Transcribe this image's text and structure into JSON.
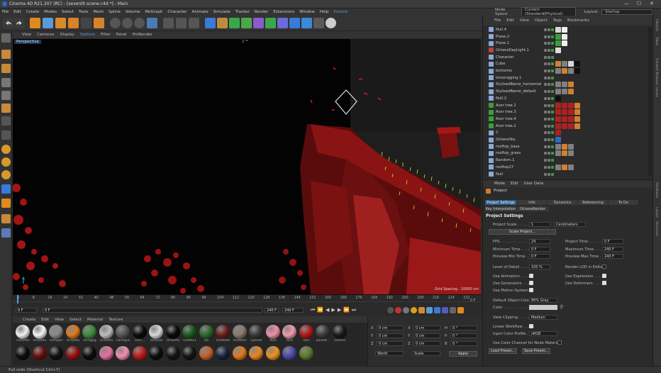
{
  "window": {
    "title": "Cinema 4D R21.207 (RC) - [seventh scene.c4d *] - Main"
  },
  "menu": [
    "File",
    "Edit",
    "Create",
    "Modes",
    "Select",
    "Tools",
    "Mesh",
    "Spline",
    "Volume",
    "MoGraph",
    "Character",
    "Animate",
    "Simulate",
    "Tracker",
    "Render",
    "Extensions",
    "Window",
    "Help",
    "Octane"
  ],
  "node_space": {
    "label": "Node Space:",
    "value": "Current (Standard/Physical)",
    "layout_label": "Layout:",
    "layout_value": "Startup"
  },
  "viewport_menu": [
    "View",
    "Cameras",
    "Display",
    "Options",
    "Filter",
    "Panel",
    "ProRender"
  ],
  "viewport": {
    "name": "Perspective",
    "top_label": "2 ⁰⁰",
    "grid_spacing": "Grid Spacing : 10000 cm"
  },
  "timeline": {
    "ticks": [
      "0",
      "8",
      "16",
      "24",
      "32",
      "40",
      "48",
      "56",
      "64",
      "72",
      "80",
      "88",
      "96",
      "104",
      "112",
      "120",
      "128",
      "136",
      "144",
      "152",
      "160",
      "168",
      "176",
      "184",
      "192",
      "200",
      "208",
      "216",
      "224",
      "232"
    ],
    "end_label": "0 F",
    "current": "0 F",
    "frame_field": "0 F",
    "start_field": "240 F",
    "end_field": "240 F"
  },
  "material_menu": [
    "Create",
    "Edit",
    "View",
    "Select",
    "Material",
    "Texture"
  ],
  "materials": [
    {
      "label": "OctDiffu",
      "color": "#f2f2f2"
    },
    {
      "label": "OctDiffu",
      "color": "#f5f5f5"
    },
    {
      "label": "OctSpec",
      "color": "#8a8a8a"
    },
    {
      "label": "OctDiffu",
      "color": "#e07a1e"
    },
    {
      "label": "stringlig",
      "color": "#3d8a3a"
    },
    {
      "label": "OctDiffu",
      "color": "#bdbdbd"
    },
    {
      "label": "cardrgisi",
      "color": "#555555"
    },
    {
      "label": "com...",
      "color": "#0b0b0b"
    },
    {
      "label": "OctGlos",
      "color": "#d8d8d8"
    },
    {
      "label": "OctDiffu",
      "color": "#0a0a0a"
    },
    {
      "label": "OctMix1",
      "color": "#1a5a1a"
    },
    {
      "label": "vei",
      "color": "#2a6a2a"
    },
    {
      "label": "OctMete",
      "color": "#6e1e1e"
    },
    {
      "label": "OctMete",
      "color": "#8a7a6a"
    },
    {
      "label": "eyesah",
      "color": "#3a3a3a"
    },
    {
      "label": "face",
      "color": "#ee8fa8"
    },
    {
      "label": "face",
      "color": "#f29bb0"
    },
    {
      "label": "hair",
      "color": "#b01818"
    },
    {
      "label": "packet...",
      "color": "#3a3a3a"
    },
    {
      "label": "clothes",
      "color": "#1a1a1a"
    },
    {
      "label": "",
      "color": "#0e0e0e"
    },
    {
      "label": "",
      "color": "#6a0f0f"
    },
    {
      "label": "",
      "color": "#111111"
    },
    {
      "label": "",
      "color": "#9a1010"
    },
    {
      "label": "",
      "color": "#0c0c0c"
    },
    {
      "label": "",
      "color": "#e86fa0"
    },
    {
      "label": "",
      "color": "#f08fb0"
    },
    {
      "label": "",
      "color": "#c41a1a"
    },
    {
      "label": "",
      "color": "#0d0d0d"
    },
    {
      "label": "",
      "color": "#151515"
    },
    {
      "label": "",
      "color": "#141414"
    },
    {
      "label": "",
      "color": "#c2602a"
    },
    {
      "label": "",
      "color": "#1a2440"
    },
    {
      "label": "",
      "color": "#e07a1e"
    },
    {
      "label": "",
      "color": "#e8871e"
    },
    {
      "label": "",
      "color": "#f0901e"
    },
    {
      "label": "",
      "color": "#4a4ab0"
    },
    {
      "label": "",
      "color": "#5a7a2a"
    }
  ],
  "coords": {
    "rows": [
      [
        "X",
        "0 cm",
        "X",
        "0 cm",
        "H",
        "0 °"
      ],
      [
        "Y",
        "0 cm",
        "Y",
        "0 cm",
        "P",
        "0 °"
      ],
      [
        "Z",
        "0 cm",
        "Z",
        "0 cm",
        "B",
        "0 °"
      ]
    ],
    "mode": "World",
    "scale": "Scale",
    "apply": "Apply"
  },
  "object_manager": {
    "menu": [
      "File",
      "Edit",
      "View",
      "Object",
      "Tags",
      "Bookmarks"
    ],
    "objects": [
      {
        "name": "Null.4",
        "color": "#8aa8d8",
        "tags": [
          "#d8d8d8",
          "#eee"
        ]
      },
      {
        "name": "Plane.2",
        "color": "#8aa8d8",
        "tags": [
          "#3c9c3c",
          "#f0f0f0"
        ]
      },
      {
        "name": "Plane.1",
        "color": "#8aa8d8",
        "tags": [
          "#3c9c3c",
          "#f0f0f0"
        ]
      },
      {
        "name": "OctaneDayLight.1",
        "color": "#c04040",
        "tags": [
          "#ddd"
        ]
      },
      {
        "name": "Character",
        "color": "#8aa8d8",
        "tags": []
      },
      {
        "name": "Cube",
        "color": "#8aa8d8",
        "tags": [
          "#d08030",
          "#808080",
          "#d8d8d8",
          "#101010"
        ]
      },
      {
        "name": "bottomis",
        "color": "#8aa8d8",
        "tags": [
          "#808080",
          "#d08030",
          "#808080",
          "#101010"
        ]
      },
      {
        "name": "torsorigging.1",
        "color": "#8aa8d8",
        "tags": []
      },
      {
        "name": "StylizedBarne_horizontal",
        "color": "#8aa8d8",
        "tags": [
          "#808080",
          "#808080",
          "#d08030"
        ]
      },
      {
        "name": "StylizedBarne_default",
        "color": "#8aa8d8",
        "tags": [
          "#808080",
          "#808080",
          "#d08030"
        ]
      },
      {
        "name": "Null.2",
        "color": "#8aa8d8",
        "tags": [
          "#101010"
        ]
      },
      {
        "name": "Acer tree.1",
        "color": "#3c9c3c",
        "tags": [
          "#b02020",
          "#b02020",
          "#b02020",
          "#d08030"
        ]
      },
      {
        "name": "Acer tree.3",
        "color": "#3c9c3c",
        "tags": [
          "#b02020",
          "#b02020",
          "#b02020",
          "#d08030"
        ]
      },
      {
        "name": "Acer tree.4",
        "color": "#3c9c3c",
        "tags": [
          "#b02020",
          "#b02020",
          "#b02020",
          "#d08030"
        ]
      },
      {
        "name": "Acer tree.2",
        "color": "#3c9c3c",
        "tags": [
          "#b02020",
          "#b02020",
          "#b02020",
          "#d08030"
        ]
      },
      {
        "name": "2",
        "color": "#8aa8d8",
        "tags": [
          "#b02020"
        ]
      },
      {
        "name": "OctaneSky",
        "color": "#8aa8d8",
        "tags": [
          "#2a6ad0"
        ]
      },
      {
        "name": "rooftop_base",
        "color": "#8aa8d8",
        "tags": [
          "#808080",
          "#d08030",
          "#808080"
        ]
      },
      {
        "name": "rooftop_grass",
        "color": "#8aa8d8",
        "tags": [
          "#808080",
          "#d08030",
          "#808080"
        ]
      },
      {
        "name": "Random.1",
        "color": "#8aa8d8",
        "tags": []
      },
      {
        "name": "rooftop27",
        "color": "#8aa8d8",
        "tags": [
          "#808080",
          "#d08030",
          "#808080"
        ]
      },
      {
        "name": "Null",
        "color": "#8aa8d8",
        "tags": []
      }
    ]
  },
  "attributes": {
    "menu": [
      "Mode",
      "Edit",
      "User Data"
    ],
    "header": "Project",
    "tabs1": [
      "Project Settings",
      "Info",
      "Dynamics",
      "Referencing",
      "To Do"
    ],
    "tabs2": [
      "Key Interpolation",
      "OctaneRender"
    ],
    "section": "Project Settings",
    "project_scale_label": "Project Scale . . . . . . .",
    "project_scale_value": "1",
    "project_scale_unit": "Centimeters",
    "scale_project_btn": "Scale Project...",
    "fps_label": "FPS . . . . . . . . . . . . . .",
    "fps_value": "24",
    "project_time_label": "Project Time . . . . . . .",
    "project_time_value": "0 F",
    "min_time_label": "Minimum Time . . . . . .",
    "min_time_value": "0 F",
    "max_time_label": "Maximum Time . . . . . .",
    "max_time_value": "240 F",
    "prev_min_label": "Preview Min Time . . .",
    "prev_min_value": "0 F",
    "prev_max_label": "Preview Max Time . . .",
    "prev_max_value": "240 F",
    "lod_label": "Level of Detail . . . . . .",
    "lod_value": "100 %",
    "render_lod_label": "Render LOD in Editor",
    "use_animation": "Use Animation . . . . . .",
    "use_expression": "Use Expression . . . . .",
    "use_generators": "Use Generators . . . . .",
    "use_deformers": "Use Deformers . . . . .",
    "use_motion": "Use Motion System . .",
    "default_color_label": "Default Object Color",
    "default_color_value": "80% Gray",
    "color_label": "Color . . . . . . . . . . . .",
    "view_clipping_label": "View Clipping . . . . . . .",
    "view_clipping_value": "Medium",
    "linear_workflow_label": "Linear Workflow . . . . .",
    "input_color_label": "Input Color Profile . . .",
    "input_color_value": "sRGB",
    "color_channel_label": "Use Color Channel for Node Material",
    "load_preset": "Load Preset...",
    "save_preset": "Save Preset..."
  },
  "right_tabs": [
    "Objects",
    "Takes",
    "Content Browser",
    "Layers",
    "Attributes",
    "Layers",
    "Structure"
  ],
  "status": "Full redo (Shortcut Ctrl+Y)"
}
